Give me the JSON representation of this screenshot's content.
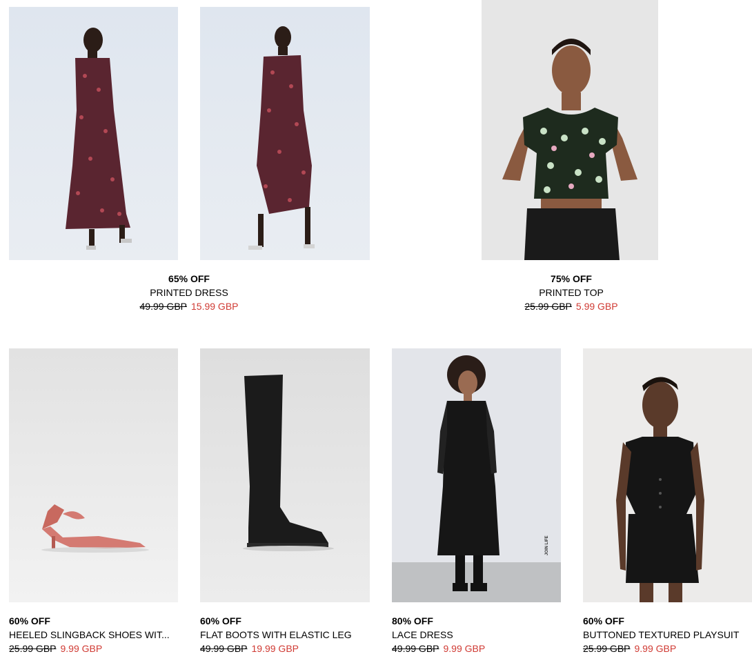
{
  "accent": {
    "sale_price_color": "#d03a33"
  },
  "products": [
    {
      "discount": "65% OFF",
      "name": "PRINTED DRESS",
      "old_price": "49.99 GBP",
      "new_price": "15.99 GBP"
    },
    {
      "discount": "75% OFF",
      "name": "PRINTED TOP",
      "old_price": "25.99 GBP",
      "new_price": "5.99 GBP"
    },
    {
      "discount": "60% OFF",
      "name": "HEELED SLINGBACK SHOES WIT...",
      "old_price": "25.99 GBP",
      "new_price": "9.99 GBP"
    },
    {
      "discount": "60% OFF",
      "name": "FLAT BOOTS WITH ELASTIC LEG",
      "old_price": "49.99 GBP",
      "new_price": "19.99 GBP"
    },
    {
      "discount": "80% OFF",
      "name": "LACE DRESS",
      "old_price": "49.99 GBP",
      "new_price": "9.99 GBP"
    },
    {
      "discount": "60% OFF",
      "name": "BUTTONED TEXTURED PLAYSUIT",
      "old_price": "25.99 GBP",
      "new_price": "9.99 GBP"
    }
  ],
  "images": {
    "lace_dress_vertical_text": "JOIN LIFE"
  }
}
